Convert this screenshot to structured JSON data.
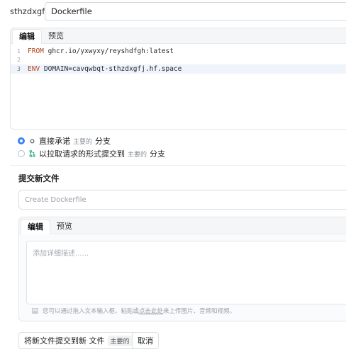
{
  "path": {
    "prefix": "sthzdxgfj//",
    "filename": "Dockerfile"
  },
  "editor": {
    "tabs": [
      {
        "label": "编辑",
        "active": true
      },
      {
        "label": "预览",
        "active": false
      }
    ],
    "lines": [
      {
        "number": "1",
        "keyword": "FROM",
        "text": " ghcr.io/yxwyxy/reyshdfgh:latest"
      },
      {
        "number": "2",
        "keyword": "",
        "text": ""
      },
      {
        "number": "3",
        "keyword": "ENV",
        "text": " DOMAIN=cavqwbqt-sthzdxgfj.hf.space"
      }
    ],
    "active_line": 3
  },
  "commit_options": {
    "direct": {
      "label": "直接承诺",
      "branch_chip": "主要的",
      "suffix": "分支",
      "checked": true
    },
    "pull_request": {
      "label": "以拉取请求的形式提交到",
      "branch_chip": "主要的",
      "suffix": "分支",
      "checked": false
    }
  },
  "new_file": {
    "title": "提交新文件",
    "summary_placeholder": "Create Dockerfile",
    "tabs": [
      {
        "label": "编辑",
        "active": true
      },
      {
        "label": "预览",
        "active": false
      }
    ],
    "description_placeholder": "添加详细描述......",
    "upload_hint_prefix": "您可以通过拖入文本输入框、粘贴或",
    "upload_hint_link": "点击此处",
    "upload_hint_suffix": "来上传图片、音频和视频。"
  },
  "actions": {
    "commit_label": "将新文件提交到新 文件",
    "commit_branch_chip": "主要的",
    "cancel_label": "取消"
  },
  "colors": {
    "accent": "#3b82f6",
    "keyword": "#b0451c",
    "active_line": "#eef3fc"
  }
}
